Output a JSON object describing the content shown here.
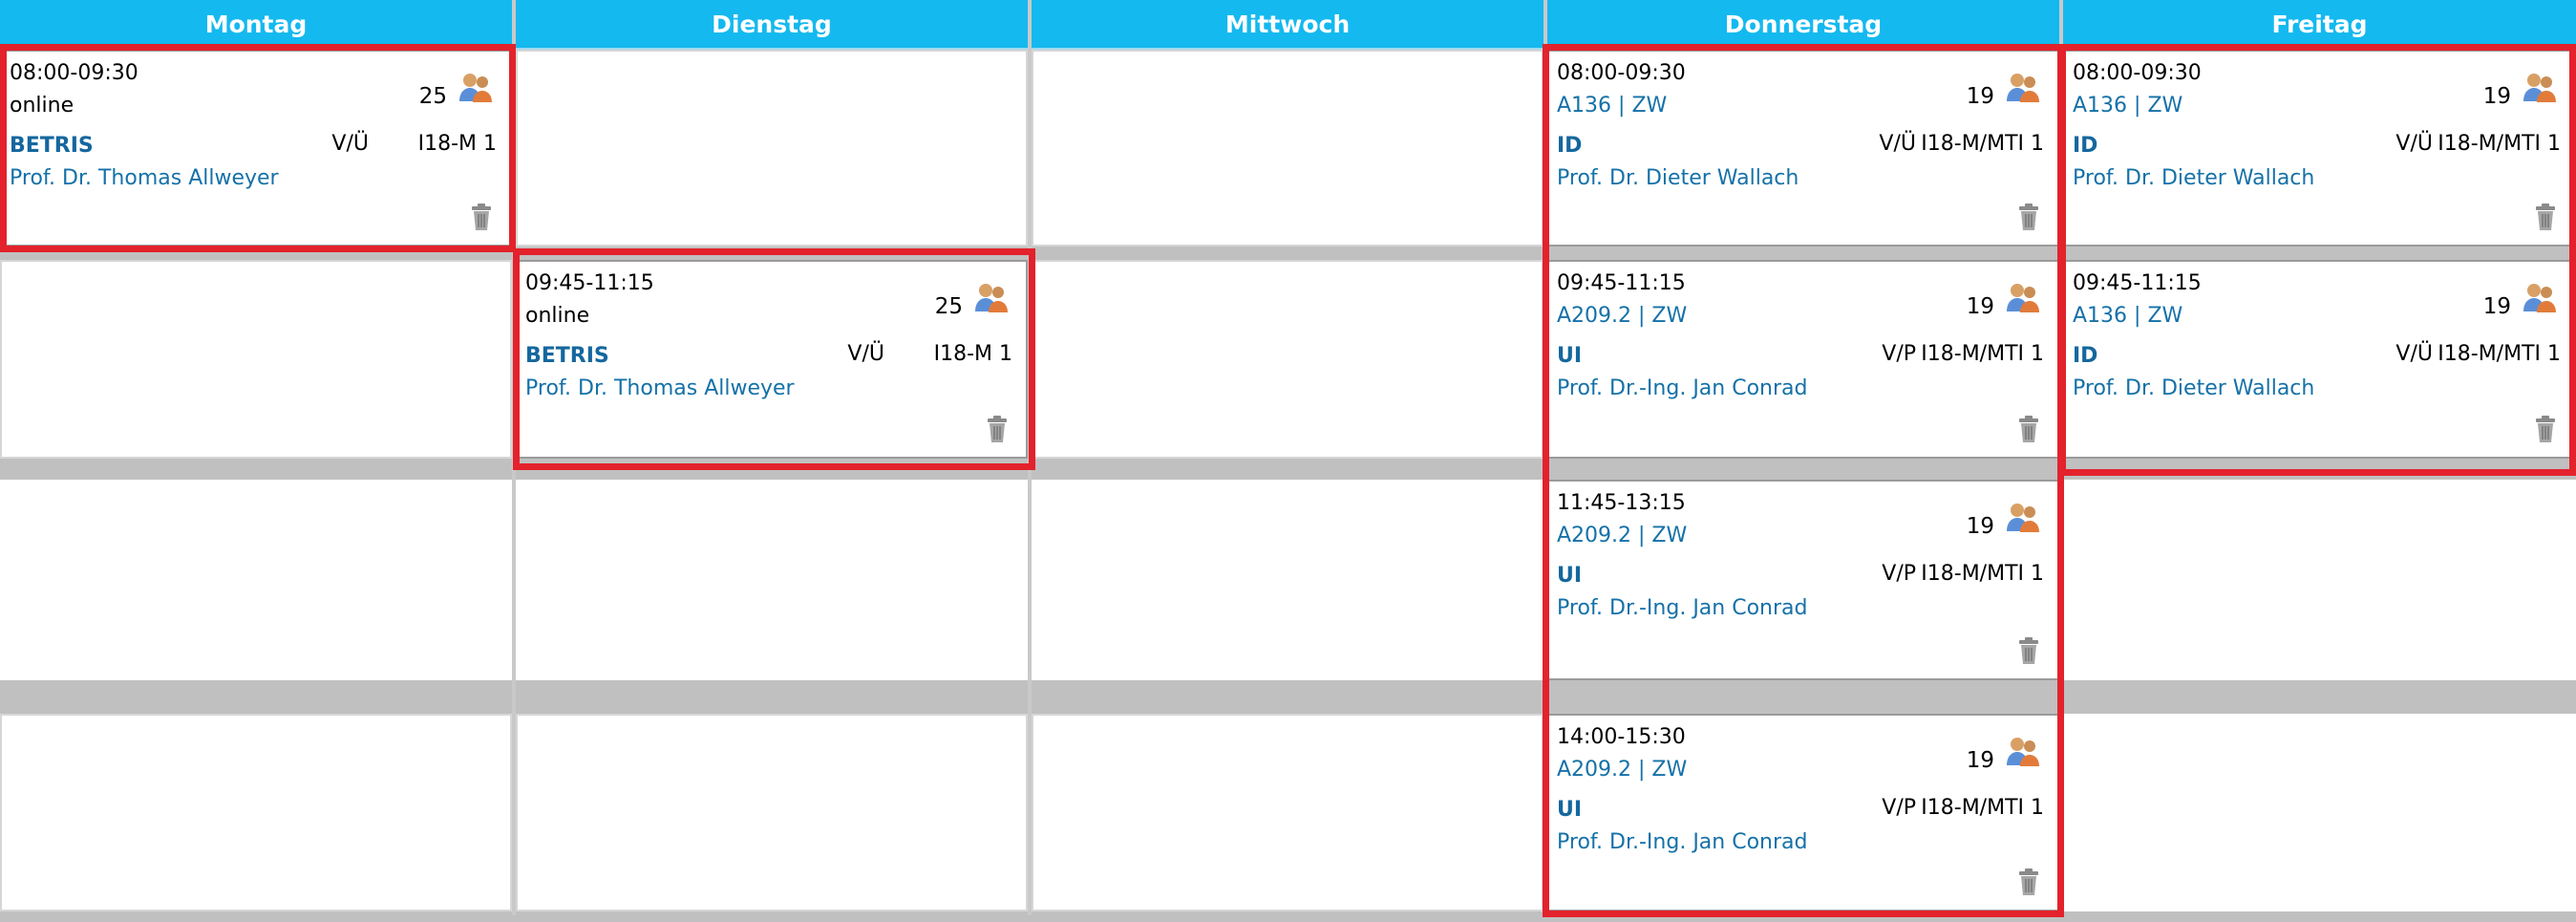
{
  "days": [
    "Montag",
    "Dienstag",
    "Mittwoch",
    "Donnerstag",
    "Freitag"
  ],
  "sessions": {
    "mo1": {
      "time": "08:00-09:30",
      "room": "online",
      "count": "25",
      "module": "BETRIS",
      "type": "V/Ü",
      "group": "I18-M 1",
      "prof": "Prof. Dr. Thomas Allweyer"
    },
    "di2": {
      "time": "09:45-11:15",
      "room": "online",
      "count": "25",
      "module": "BETRIS",
      "type": "V/Ü",
      "group": "I18-M 1",
      "prof": "Prof. Dr. Thomas Allweyer"
    },
    "do1": {
      "time": "08:00-09:30",
      "room": "A136 | ZW",
      "count": "19",
      "module": "ID",
      "type": "V/Ü",
      "group": "I18-M/MTI 1",
      "prof": "Prof. Dr. Dieter Wallach"
    },
    "do2": {
      "time": "09:45-11:15",
      "room": "A209.2 | ZW",
      "count": "19",
      "module": "UI",
      "type": "V/P",
      "group": "I18-M/MTI 1",
      "prof": "Prof. Dr.-Ing. Jan Conrad"
    },
    "do3": {
      "time": "11:45-13:15",
      "room": "A209.2 | ZW",
      "count": "19",
      "module": "UI",
      "type": "V/P",
      "group": "I18-M/MTI 1",
      "prof": "Prof. Dr.-Ing. Jan Conrad"
    },
    "do4": {
      "time": "14:00-15:30",
      "room": "A209.2 | ZW",
      "count": "19",
      "module": "UI",
      "type": "V/P",
      "group": "I18-M/MTI 1",
      "prof": "Prof. Dr.-Ing. Jan Conrad"
    },
    "fr1": {
      "time": "08:00-09:30",
      "room": "A136 | ZW",
      "count": "19",
      "module": "ID",
      "type": "V/Ü",
      "group": "I18-M/MTI 1",
      "prof": "Prof. Dr. Dieter Wallach"
    },
    "fr2": {
      "time": "09:45-11:15",
      "room": "A136 | ZW",
      "count": "19",
      "module": "ID",
      "type": "V/Ü",
      "group": "I18-M/MTI 1",
      "prof": "Prof. Dr. Dieter Wallach"
    }
  },
  "icons": {
    "participants": "people-icon",
    "delete": "trash-icon"
  },
  "colors": {
    "header": "#14b9ef",
    "link": "#1571a8",
    "highlight": "#e3222c",
    "band": "#c0c0c0"
  }
}
